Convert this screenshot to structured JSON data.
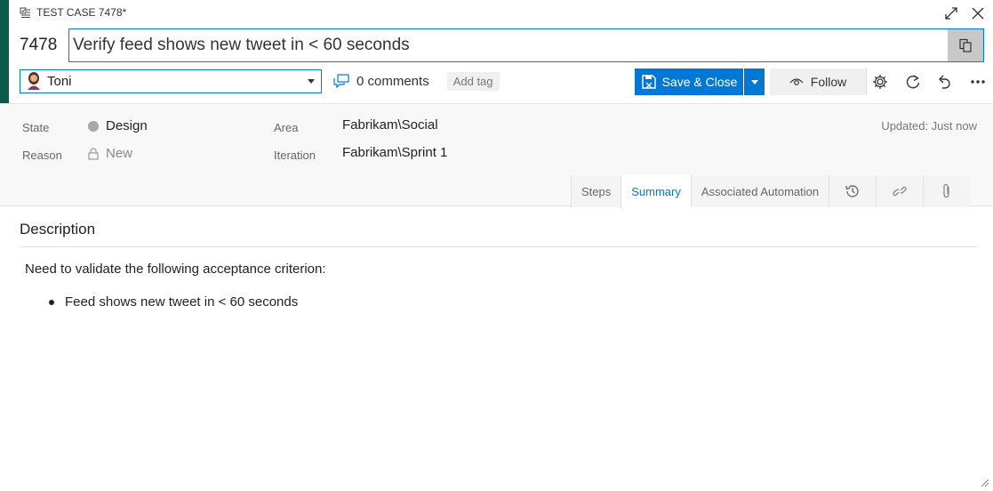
{
  "work_item": {
    "type_label": "TEST CASE 7478*",
    "id": "7478",
    "title": "Verify feed shows new tweet in < 60 seconds"
  },
  "toolbar": {
    "assigned_to": "Toni",
    "comments": "0 comments",
    "add_tag": "Add tag",
    "save_close": "Save & Close",
    "follow": "Follow"
  },
  "fields": {
    "state_label": "State",
    "state_value": "Design",
    "reason_label": "Reason",
    "reason_value": "New",
    "area_label": "Area",
    "area_value": "Fabrikam\\Social",
    "iteration_label": "Iteration",
    "iteration_value": "Fabrikam\\Sprint 1",
    "updated": "Updated: Just now"
  },
  "tabs": [
    {
      "label": "Steps"
    },
    {
      "label": "Summary"
    },
    {
      "label": "Associated Automation"
    }
  ],
  "active_tab": "Summary",
  "icons": [
    "test-case-icon",
    "expand-icon",
    "close-icon",
    "copy-icon",
    "avatar",
    "chevron-down-icon",
    "comment-icon",
    "save-icon",
    "eye-icon",
    "gear-icon",
    "refresh-icon",
    "undo-icon",
    "more-icon",
    "history-icon",
    "link-icon",
    "attachment-icon",
    "lock-icon"
  ],
  "description": {
    "heading": "Description",
    "intro": "Need to validate the following acceptance criterion:",
    "bullets": [
      "Feed shows new tweet in < 60 seconds"
    ]
  },
  "colors": {
    "accent": "#0b5a4a",
    "primary": "#0078d4",
    "state_dot": "#a8a8a8"
  }
}
